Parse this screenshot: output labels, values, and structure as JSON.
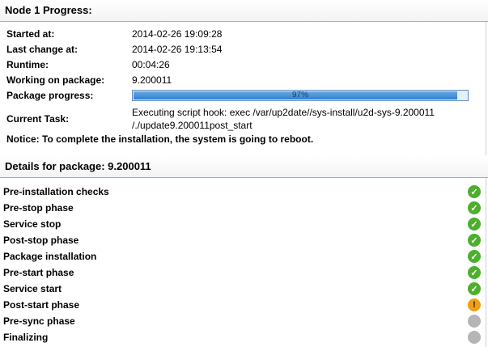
{
  "node_section": {
    "title": "Node 1 Progress:",
    "rows": [
      {
        "label": "Started at:",
        "value": "2014-02-26 19:09:28"
      },
      {
        "label": "Last change at:",
        "value": "2014-02-26 19:13:54"
      },
      {
        "label": "Runtime:",
        "value": "00:04:26"
      },
      {
        "label": "Working on package:",
        "value": "9.200011"
      }
    ],
    "progress": {
      "label": "Package progress:",
      "percent": 97,
      "text": "97%"
    },
    "task": {
      "label": "Current Task:",
      "line1": "Executing script hook: exec /var/up2date//sys-install/u2d-sys-9.200011",
      "line2": "/./update9.200011post_start"
    },
    "notice": "Notice: To complete the installation, the system is going to reboot."
  },
  "details_section": {
    "title": "Details for package: 9.200011",
    "phases": [
      {
        "label": "Pre-installation checks",
        "status": "done",
        "icon": "check-icon"
      },
      {
        "label": "Pre-stop phase",
        "status": "done",
        "icon": "check-icon"
      },
      {
        "label": "Service stop",
        "status": "done",
        "icon": "check-icon"
      },
      {
        "label": "Post-stop phase",
        "status": "done",
        "icon": "check-icon"
      },
      {
        "label": "Package installation",
        "status": "done",
        "icon": "check-icon"
      },
      {
        "label": "Pre-start phase",
        "status": "done",
        "icon": "check-icon"
      },
      {
        "label": "Service start",
        "status": "done",
        "icon": "check-icon"
      },
      {
        "label": "Post-start phase",
        "status": "in-progress",
        "icon": "exclamation-icon"
      },
      {
        "label": "Pre-sync phase",
        "status": "pending",
        "icon": "pending-icon"
      },
      {
        "label": "Finalizing",
        "status": "pending",
        "icon": "pending-icon"
      }
    ]
  },
  "colors": {
    "accent_rule": "#e8a04a",
    "ok": "#4caf2e",
    "warn": "#f0a012",
    "pending": "#b5b5b5",
    "progress": "#2f7fcf"
  }
}
